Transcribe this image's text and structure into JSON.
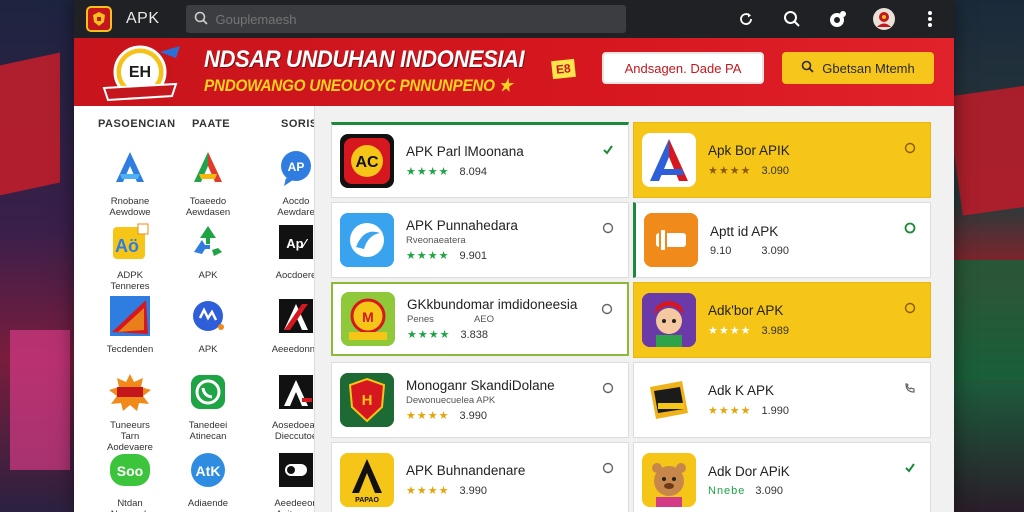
{
  "topbar": {
    "title": "APK",
    "search_placeholder": "Gouplemaesh"
  },
  "banner": {
    "title": "NDSAR UNDUHAN INDONESIAI",
    "subtitle": "PNDOWANGO UNEOUOYC PNNUNPENO ★",
    "tag": "E8",
    "button_white": "Andsagen. Dade PA",
    "button_yellow": "Gbetsan Mtemh"
  },
  "left_panel": {
    "columns": [
      "PASOENCIAN",
      "PAATE",
      "SORISE"
    ],
    "items": [
      {
        "label": "Rnobane Aewdowe",
        "icon": "blue-a-icon"
      },
      {
        "label": "Toaeedo Aewdasen",
        "icon": "colorful-a-icon"
      },
      {
        "label": "Aocdo Aewdare",
        "icon": "blue-chat-icon"
      },
      {
        "label": "ADPK Tenneres",
        "icon": "yellow-a-icon"
      },
      {
        "label": "APK",
        "icon": "green-recycle-icon"
      },
      {
        "label": "Aocdoere",
        "icon": "black-ap-icon"
      },
      {
        "label": "Tecdenden",
        "icon": "red-flag-icon"
      },
      {
        "label": "APK",
        "icon": "blue-bubble-icon"
      },
      {
        "label": "Aeeedonna",
        "icon": "black-a-icon"
      },
      {
        "label": "Tuneeurs Tarn Aodevaere",
        "icon": "burst-badge-icon"
      },
      {
        "label": "Tanedeei Atinecan",
        "icon": "green-phone-icon"
      },
      {
        "label": "Aosedoean Dieccutoe",
        "icon": "black-a2-icon"
      },
      {
        "label": "Ntdan Naeneeh",
        "icon": "green-soo-icon"
      },
      {
        "label": "Adiaende",
        "icon": "blue-apk-icon"
      },
      {
        "label": "Aeedeeon Aoitmeno",
        "icon": "black-toggle-icon"
      }
    ]
  },
  "cards": [
    {
      "title": "APK Parl lMoonana",
      "sub": "",
      "rating_stars": "★★★★",
      "score": "8.094",
      "icon": "red-ac-icon",
      "mark": "check-icon"
    },
    {
      "title": "Apk Bor APIK",
      "sub": "",
      "rating_stars": "★★★★",
      "score": "3.090",
      "icon": "red-blue-a-icon",
      "mark": "circle-icon"
    },
    {
      "title": "APK Punnahedara",
      "sub": "Rveonaeatera",
      "rating_stars": "★★★★",
      "score": "9.901",
      "icon": "blue-swirl-icon",
      "mark": "circle-icon"
    },
    {
      "title": "Aptt id APK",
      "sub": "",
      "rating_stars": "",
      "score": "3.090",
      "extra": "9.10",
      "icon": "orange-switch-icon",
      "mark": "green-circle-icon"
    },
    {
      "title": "GKkbundomar imdidoneesia",
      "sub": "Penes",
      "sub2": "AEO",
      "rating_stars": "★★★★",
      "score": "3.838",
      "icon": "green-badge-icon",
      "mark": "circle-icon"
    },
    {
      "title": "Adk'bor APK",
      "sub": "",
      "rating_stars": "★★★★",
      "score": "3.989",
      "icon": "girl-character-icon",
      "mark": "circle-icon"
    },
    {
      "title": "Monoganr SkandiDolane",
      "sub": "Dewonuecuelea APK",
      "rating_stars": "★★★★",
      "score": "3.990",
      "icon": "shield-badge-icon",
      "mark": "circle-icon"
    },
    {
      "title": "Adk K APK",
      "sub": "",
      "rating_stars": "★★★★",
      "score": "1.990",
      "icon": "gold-box-icon",
      "mark": "call-icon"
    },
    {
      "title": "APK Buhnandenare",
      "sub": "",
      "rating_stars": "★★★★",
      "score": "3.990",
      "icon": "yellow-a-papa-icon",
      "mark": "circle-icon"
    },
    {
      "title": "Adk Dor APiK",
      "sub": "",
      "rating_stars": "Nnebe",
      "score": "3.090",
      "icon": "bear-character-icon",
      "mark": "check-icon"
    }
  ],
  "colors": {
    "topbar": "#202124",
    "banner_red": "#d6171f",
    "accent_yellow": "#f5c517",
    "accent_green": "#1d8a3a"
  }
}
